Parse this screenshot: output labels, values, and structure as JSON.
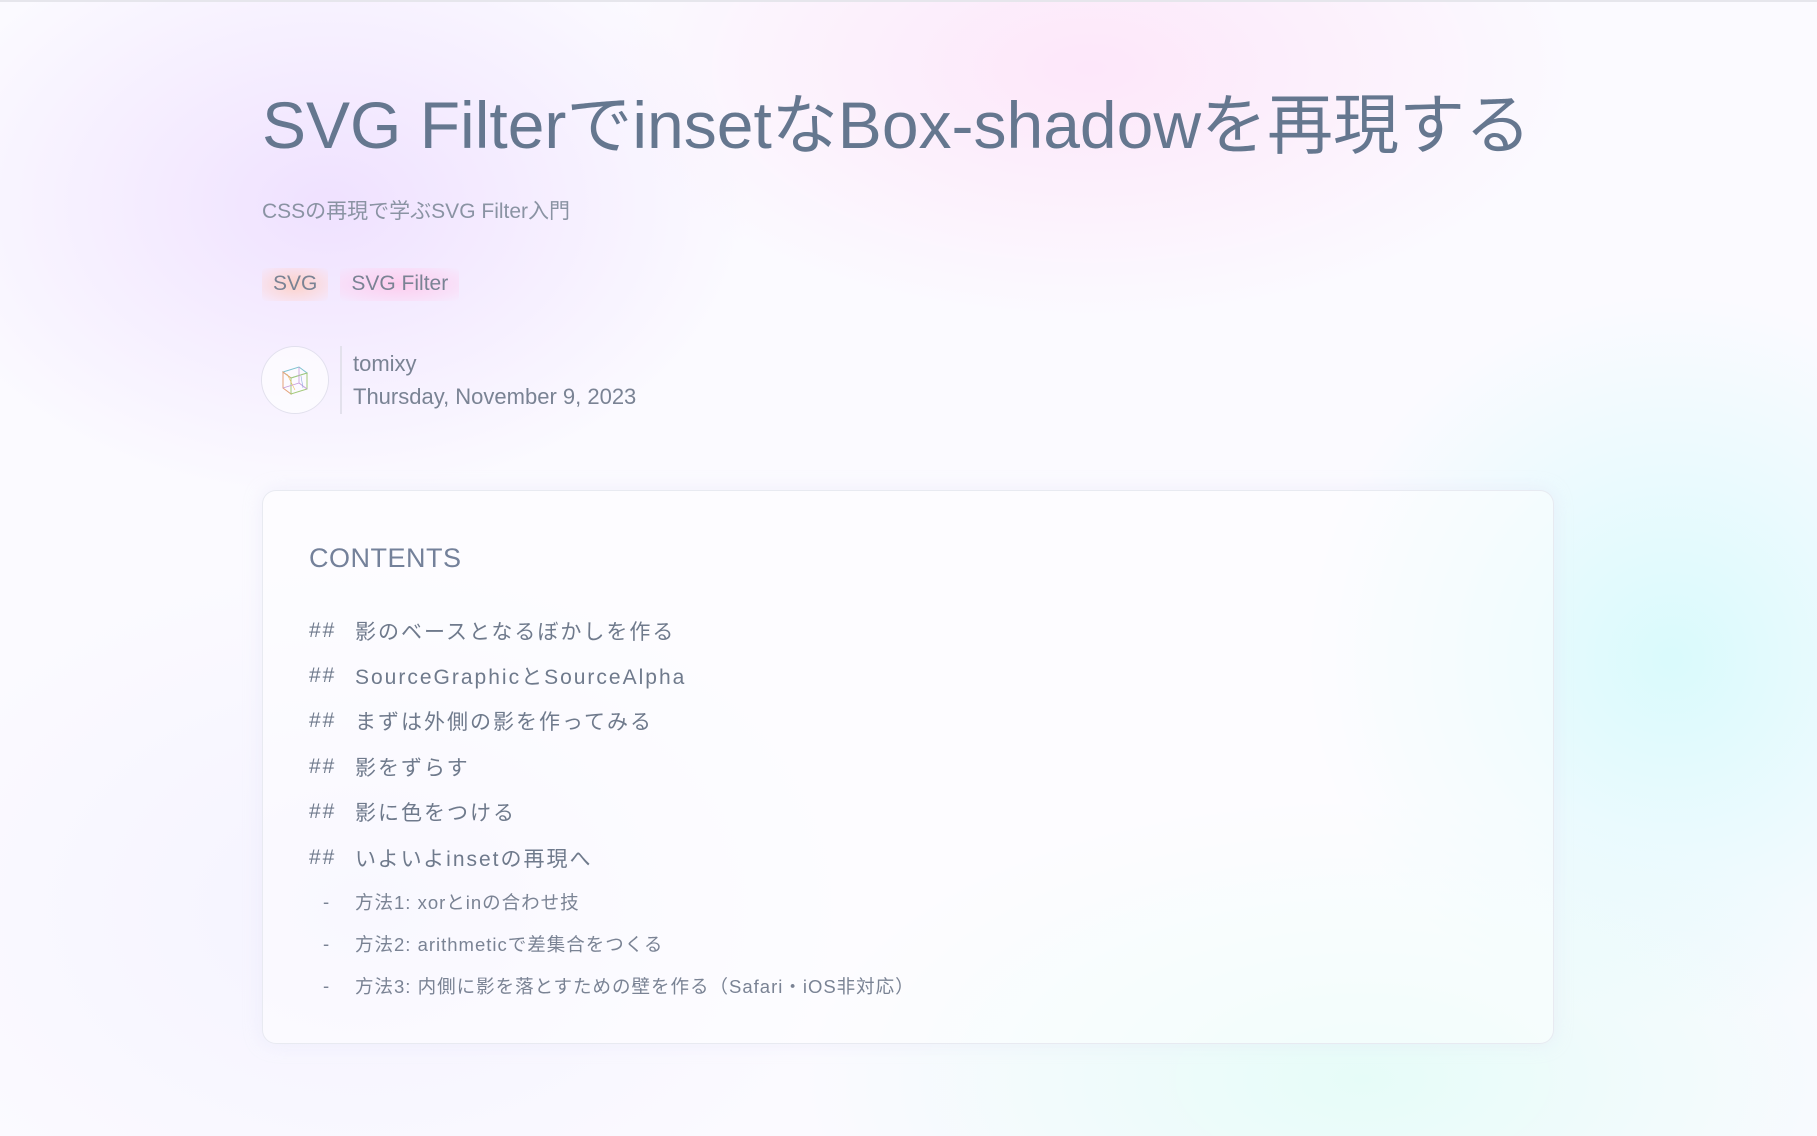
{
  "article": {
    "title": "SVG FilterでinsetなBox-shadowを再現する",
    "subtitle": "CSSの再現で学ぶSVG Filter入門",
    "tags": [
      "SVG",
      "SVG Filter"
    ],
    "author": {
      "name": "tomixy",
      "date": "Thursday, November 9, 2023",
      "avatar_icon": "cube-sketch-icon"
    }
  },
  "toc": {
    "heading": "CONTENTS",
    "items": [
      {
        "mark": "##",
        "label": "影のベースとなるぼかしを作る"
      },
      {
        "mark": "##",
        "label": "SourceGraphicとSourceAlpha"
      },
      {
        "mark": "##",
        "label": "まずは外側の影を作ってみる"
      },
      {
        "mark": "##",
        "label": "影をずらす"
      },
      {
        "mark": "##",
        "label": "影に色をつける"
      },
      {
        "mark": "##",
        "label": "いよいよinsetの再現へ"
      }
    ],
    "subitems": [
      {
        "mark": "-",
        "label": "方法1: xorとinの合わせ技"
      },
      {
        "mark": "-",
        "label": "方法2: arithmeticで差集合をつくる"
      },
      {
        "mark": "-",
        "label": "方法3: 内側に影を落とすための壁を作る（Safari・iOS非対応）"
      }
    ]
  }
}
